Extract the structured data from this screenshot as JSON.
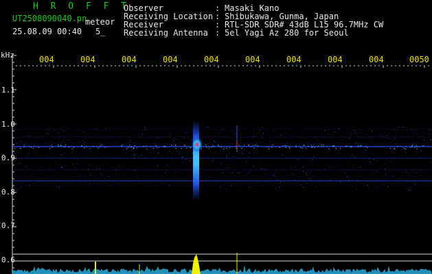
{
  "header": {
    "program_name": "H R O F F T",
    "filename": "UT2508090040.pn",
    "meteor_label": "meteor",
    "date_time": "25.08.09 00:40",
    "count": "5_",
    "info_rows": [
      {
        "label": "Observer",
        "value": "Masaki Kano"
      },
      {
        "label": "Receiving Location",
        "value": "Shibukawa, Gunma, Japan"
      },
      {
        "label": "Receiver",
        "value": "RTL-SDR SDR# 43dB L15 96.7MHz CW"
      },
      {
        "label": "Receiving Antenna",
        "value": "5el Yagi Az 280 for Seoul"
      }
    ]
  },
  "axes": {
    "y_unit": "kHz",
    "y_ticks": [
      "1.1",
      "1.0",
      "0.9",
      "0.8",
      "0.7",
      "0.6"
    ],
    "x_ticks": [
      "004",
      "004",
      "004",
      "004",
      "004",
      "004",
      "004",
      "004",
      "004",
      "0050"
    ]
  },
  "colors": {
    "background": "#000000",
    "text_green": "#18c818",
    "text_white": "#e8e8e8",
    "time_labels": "#f0e000",
    "noise_floor": "#40c8e8",
    "signal_peak": "#f0f000",
    "echo_core": "#e03060"
  }
}
